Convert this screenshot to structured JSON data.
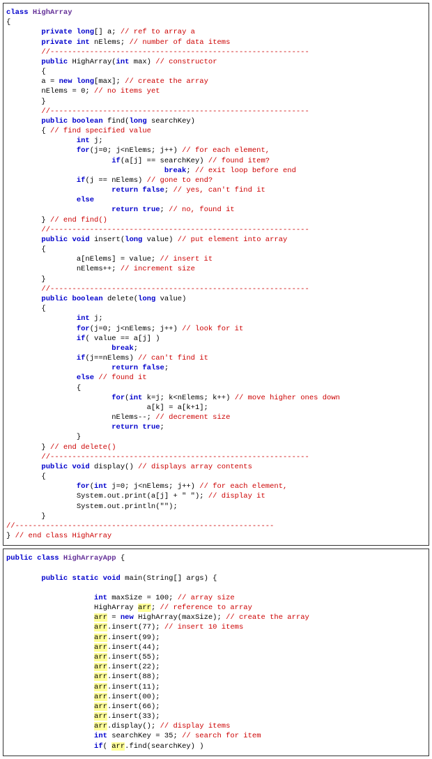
{
  "code_block_1": {
    "class_decl": "class HighArray",
    "lines": [
      {
        "indent": 0,
        "segs": [
          {
            "t": "class ",
            "c": "kw"
          },
          {
            "t": "HighArray",
            "c": "cls"
          }
        ]
      },
      {
        "indent": 0,
        "segs": [
          {
            "t": "{",
            "c": ""
          }
        ]
      },
      {
        "indent": 2,
        "segs": [
          {
            "t": "private long",
            "c": "kw"
          },
          {
            "t": "[] a; ",
            "c": ""
          },
          {
            "t": "// ref to array a",
            "c": "com"
          }
        ]
      },
      {
        "indent": 2,
        "segs": [
          {
            "t": "private int ",
            "c": "kw"
          },
          {
            "t": "nElems; ",
            "c": ""
          },
          {
            "t": "// number of data items",
            "c": "com"
          }
        ]
      },
      {
        "indent": 2,
        "segs": [
          {
            "t": "//-----------------------------------------------------------",
            "c": "com"
          }
        ]
      },
      {
        "indent": 2,
        "segs": [
          {
            "t": "public ",
            "c": "kw"
          },
          {
            "t": "HighArray(",
            "c": ""
          },
          {
            "t": "int ",
            "c": "kw"
          },
          {
            "t": "max) ",
            "c": ""
          },
          {
            "t": "// constructor",
            "c": "com"
          }
        ]
      },
      {
        "indent": 2,
        "segs": [
          {
            "t": "{",
            "c": ""
          }
        ]
      },
      {
        "indent": 2,
        "segs": [
          {
            "t": "a = ",
            "c": ""
          },
          {
            "t": "new long",
            "c": "kw"
          },
          {
            "t": "[max]; ",
            "c": ""
          },
          {
            "t": "// create the array",
            "c": "com"
          }
        ]
      },
      {
        "indent": 2,
        "segs": [
          {
            "t": "nElems = 0; ",
            "c": ""
          },
          {
            "t": "// no items yet",
            "c": "com"
          }
        ]
      },
      {
        "indent": 2,
        "segs": [
          {
            "t": "}",
            "c": ""
          }
        ]
      },
      {
        "indent": 2,
        "segs": [
          {
            "t": "//-----------------------------------------------------------",
            "c": "com"
          }
        ]
      },
      {
        "indent": 2,
        "segs": [
          {
            "t": "public boolean ",
            "c": "kw"
          },
          {
            "t": "find(",
            "c": ""
          },
          {
            "t": "long ",
            "c": "kw"
          },
          {
            "t": "searchKey)",
            "c": ""
          }
        ]
      },
      {
        "indent": 2,
        "segs": [
          {
            "t": "{ ",
            "c": ""
          },
          {
            "t": "// find specified value",
            "c": "com"
          }
        ]
      },
      {
        "indent": 4,
        "segs": [
          {
            "t": "int ",
            "c": "kw"
          },
          {
            "t": "j;",
            "c": ""
          }
        ]
      },
      {
        "indent": 4,
        "segs": [
          {
            "t": "for",
            "c": "kw"
          },
          {
            "t": "(j=0; j<nElems; j++) ",
            "c": ""
          },
          {
            "t": "// for each element,",
            "c": "com"
          }
        ]
      },
      {
        "indent": 6,
        "segs": [
          {
            "t": "if",
            "c": "kw"
          },
          {
            "t": "(a[j] == searchKey) ",
            "c": ""
          },
          {
            "t": "// found item?",
            "c": "com"
          }
        ]
      },
      {
        "indent": 9,
        "segs": [
          {
            "t": "break",
            "c": "kw"
          },
          {
            "t": "; ",
            "c": ""
          },
          {
            "t": "// exit loop before end",
            "c": "com"
          }
        ]
      },
      {
        "indent": 4,
        "segs": [
          {
            "t": "if",
            "c": "kw"
          },
          {
            "t": "(j == nElems) ",
            "c": ""
          },
          {
            "t": "// gone to end?",
            "c": "com"
          }
        ]
      },
      {
        "indent": 6,
        "segs": [
          {
            "t": "return false",
            "c": "kw"
          },
          {
            "t": "; ",
            "c": ""
          },
          {
            "t": "// yes, can't find it",
            "c": "com"
          }
        ]
      },
      {
        "indent": 4,
        "segs": [
          {
            "t": "else",
            "c": "kw"
          }
        ]
      },
      {
        "indent": 6,
        "segs": [
          {
            "t": "return true",
            "c": "kw"
          },
          {
            "t": "; ",
            "c": ""
          },
          {
            "t": "// no, found it",
            "c": "com"
          }
        ]
      },
      {
        "indent": 2,
        "segs": [
          {
            "t": "} ",
            "c": ""
          },
          {
            "t": "// end find()",
            "c": "com"
          }
        ]
      },
      {
        "indent": 2,
        "segs": [
          {
            "t": "//-----------------------------------------------------------",
            "c": "com"
          }
        ]
      },
      {
        "indent": 2,
        "segs": [
          {
            "t": "public void ",
            "c": "kw"
          },
          {
            "t": "insert(",
            "c": ""
          },
          {
            "t": "long ",
            "c": "kw"
          },
          {
            "t": "value) ",
            "c": ""
          },
          {
            "t": "// put element into array",
            "c": "com"
          }
        ]
      },
      {
        "indent": 2,
        "segs": [
          {
            "t": "{",
            "c": ""
          }
        ]
      },
      {
        "indent": 4,
        "segs": [
          {
            "t": "a[nElems] = value; ",
            "c": ""
          },
          {
            "t": "// insert it",
            "c": "com"
          }
        ]
      },
      {
        "indent": 4,
        "segs": [
          {
            "t": "nElems++; ",
            "c": ""
          },
          {
            "t": "// increment size",
            "c": "com"
          }
        ]
      },
      {
        "indent": 2,
        "segs": [
          {
            "t": "}",
            "c": ""
          }
        ]
      },
      {
        "indent": 2,
        "segs": [
          {
            "t": "//-----------------------------------------------------------",
            "c": "com"
          }
        ]
      },
      {
        "indent": 2,
        "segs": [
          {
            "t": "public boolean ",
            "c": "kw"
          },
          {
            "t": "delete(",
            "c": ""
          },
          {
            "t": "long ",
            "c": "kw"
          },
          {
            "t": "value)",
            "c": ""
          }
        ]
      },
      {
        "indent": 2,
        "segs": [
          {
            "t": "{",
            "c": ""
          }
        ]
      },
      {
        "indent": 4,
        "segs": [
          {
            "t": "int ",
            "c": "kw"
          },
          {
            "t": "j;",
            "c": ""
          }
        ]
      },
      {
        "indent": 4,
        "segs": [
          {
            "t": "for",
            "c": "kw"
          },
          {
            "t": "(j=0; j<nElems; j++) ",
            "c": ""
          },
          {
            "t": "// look for it",
            "c": "com"
          }
        ]
      },
      {
        "indent": 4,
        "segs": [
          {
            "t": "if",
            "c": "kw"
          },
          {
            "t": "( value == a[j] )",
            "c": ""
          }
        ]
      },
      {
        "indent": 6,
        "segs": [
          {
            "t": "break",
            "c": "kw"
          },
          {
            "t": ";",
            "c": ""
          }
        ]
      },
      {
        "indent": 4,
        "segs": [
          {
            "t": "if",
            "c": "kw"
          },
          {
            "t": "(j==nElems) ",
            "c": ""
          },
          {
            "t": "// can't find it",
            "c": "com"
          }
        ]
      },
      {
        "indent": 6,
        "segs": [
          {
            "t": "return false",
            "c": "kw"
          },
          {
            "t": ";",
            "c": ""
          }
        ]
      },
      {
        "indent": 4,
        "segs": [
          {
            "t": "else ",
            "c": "kw"
          },
          {
            "t": "// found it",
            "c": "com"
          }
        ]
      },
      {
        "indent": 4,
        "segs": [
          {
            "t": "{",
            "c": ""
          }
        ]
      },
      {
        "indent": 6,
        "segs": [
          {
            "t": "for",
            "c": "kw"
          },
          {
            "t": "(",
            "c": ""
          },
          {
            "t": "int ",
            "c": "kw"
          },
          {
            "t": "k=j; k<nElems; k++) ",
            "c": ""
          },
          {
            "t": "// move higher ones down",
            "c": "com"
          }
        ]
      },
      {
        "indent": 8,
        "segs": [
          {
            "t": "a[k] = a[k+1];",
            "c": ""
          }
        ]
      },
      {
        "indent": 6,
        "segs": [
          {
            "t": "nElems--; ",
            "c": ""
          },
          {
            "t": "// decrement size",
            "c": "com"
          }
        ]
      },
      {
        "indent": 6,
        "segs": [
          {
            "t": "return true",
            "c": "kw"
          },
          {
            "t": ";",
            "c": ""
          }
        ]
      },
      {
        "indent": 4,
        "segs": [
          {
            "t": "}",
            "c": ""
          }
        ]
      },
      {
        "indent": 2,
        "segs": [
          {
            "t": "} ",
            "c": ""
          },
          {
            "t": "// end delete()",
            "c": "com"
          }
        ]
      },
      {
        "indent": 2,
        "segs": [
          {
            "t": "//-----------------------------------------------------------",
            "c": "com"
          }
        ]
      },
      {
        "indent": 2,
        "segs": [
          {
            "t": "public void ",
            "c": "kw"
          },
          {
            "t": "display() ",
            "c": ""
          },
          {
            "t": "// displays array contents",
            "c": "com"
          }
        ]
      },
      {
        "indent": 2,
        "segs": [
          {
            "t": "{",
            "c": ""
          }
        ]
      },
      {
        "indent": 4,
        "segs": [
          {
            "t": "for",
            "c": "kw"
          },
          {
            "t": "(",
            "c": ""
          },
          {
            "t": "int ",
            "c": "kw"
          },
          {
            "t": "j=0; j<nElems; j++) ",
            "c": ""
          },
          {
            "t": "// for each element,",
            "c": "com"
          }
        ]
      },
      {
        "indent": 4,
        "segs": [
          {
            "t": "System.out.print(a[j] + \" \"); ",
            "c": ""
          },
          {
            "t": "// display it",
            "c": "com"
          }
        ]
      },
      {
        "indent": 4,
        "segs": [
          {
            "t": "System.out.println(\"\");",
            "c": ""
          }
        ]
      },
      {
        "indent": 2,
        "segs": [
          {
            "t": "}",
            "c": ""
          }
        ]
      },
      {
        "indent": 0,
        "segs": [
          {
            "t": "//-----------------------------------------------------------",
            "c": "com"
          }
        ]
      },
      {
        "indent": 0,
        "segs": [
          {
            "t": "} ",
            "c": ""
          },
          {
            "t": "// end class HighArray",
            "c": "com"
          }
        ]
      }
    ]
  },
  "code_block_2": {
    "lines": [
      {
        "indent": 0,
        "segs": [
          {
            "t": "public class ",
            "c": "kw"
          },
          {
            "t": "HighArrayApp ",
            "c": "cls"
          },
          {
            "t": "{",
            "c": ""
          }
        ]
      },
      {
        "indent": 0,
        "segs": [
          {
            "t": " ",
            "c": ""
          }
        ]
      },
      {
        "indent": 2,
        "segs": [
          {
            "t": "public static void ",
            "c": "kw"
          },
          {
            "t": "main(String[] args) {",
            "c": ""
          }
        ]
      },
      {
        "indent": 0,
        "segs": [
          {
            "t": " ",
            "c": ""
          }
        ]
      },
      {
        "indent": 5,
        "segs": [
          {
            "t": "int ",
            "c": "kw"
          },
          {
            "t": "maxSize = 100; ",
            "c": ""
          },
          {
            "t": "// array size",
            "c": "com"
          }
        ]
      },
      {
        "indent": 5,
        "segs": [
          {
            "t": "HighArray ",
            "c": ""
          },
          {
            "t": "arr",
            "c": "hi"
          },
          {
            "t": "; ",
            "c": ""
          },
          {
            "t": "// reference to array",
            "c": "com"
          }
        ]
      },
      {
        "indent": 5,
        "segs": [
          {
            "t": "arr",
            "c": "hi"
          },
          {
            "t": " = ",
            "c": ""
          },
          {
            "t": "new ",
            "c": "kw"
          },
          {
            "t": "HighArray(maxSize); ",
            "c": ""
          },
          {
            "t": "// create the array",
            "c": "com"
          }
        ]
      },
      {
        "indent": 5,
        "segs": [
          {
            "t": "arr",
            "c": "hi"
          },
          {
            "t": ".insert(77); ",
            "c": ""
          },
          {
            "t": "// insert 10 items",
            "c": "com"
          }
        ]
      },
      {
        "indent": 5,
        "segs": [
          {
            "t": "arr",
            "c": "hi"
          },
          {
            "t": ".insert(99);",
            "c": ""
          }
        ]
      },
      {
        "indent": 5,
        "segs": [
          {
            "t": "arr",
            "c": "hi"
          },
          {
            "t": ".insert(44);",
            "c": ""
          }
        ]
      },
      {
        "indent": 5,
        "segs": [
          {
            "t": "arr",
            "c": "hi"
          },
          {
            "t": ".insert(55);",
            "c": ""
          }
        ]
      },
      {
        "indent": 5,
        "segs": [
          {
            "t": "arr",
            "c": "hi"
          },
          {
            "t": ".insert(22);",
            "c": ""
          }
        ]
      },
      {
        "indent": 5,
        "segs": [
          {
            "t": "arr",
            "c": "hi"
          },
          {
            "t": ".insert(88);",
            "c": ""
          }
        ]
      },
      {
        "indent": 5,
        "segs": [
          {
            "t": "arr",
            "c": "hi"
          },
          {
            "t": ".insert(11);",
            "c": ""
          }
        ]
      },
      {
        "indent": 5,
        "segs": [
          {
            "t": "arr",
            "c": "hi"
          },
          {
            "t": ".insert(00);",
            "c": ""
          }
        ]
      },
      {
        "indent": 5,
        "segs": [
          {
            "t": "arr",
            "c": "hi"
          },
          {
            "t": ".insert(66);",
            "c": ""
          }
        ]
      },
      {
        "indent": 5,
        "segs": [
          {
            "t": "arr",
            "c": "hi"
          },
          {
            "t": ".insert(33);",
            "c": ""
          }
        ]
      },
      {
        "indent": 5,
        "segs": [
          {
            "t": "arr",
            "c": "hi"
          },
          {
            "t": ".display(); ",
            "c": ""
          },
          {
            "t": "// display items",
            "c": "com"
          }
        ]
      },
      {
        "indent": 5,
        "segs": [
          {
            "t": "int ",
            "c": "kw"
          },
          {
            "t": "searchKey = 35; ",
            "c": ""
          },
          {
            "t": "// search for item",
            "c": "com"
          }
        ]
      },
      {
        "indent": 5,
        "segs": [
          {
            "t": "if",
            "c": "kw"
          },
          {
            "t": "( ",
            "c": ""
          },
          {
            "t": "arr",
            "c": "hi"
          },
          {
            "t": ".find(searchKey) )",
            "c": ""
          }
        ]
      }
    ]
  }
}
